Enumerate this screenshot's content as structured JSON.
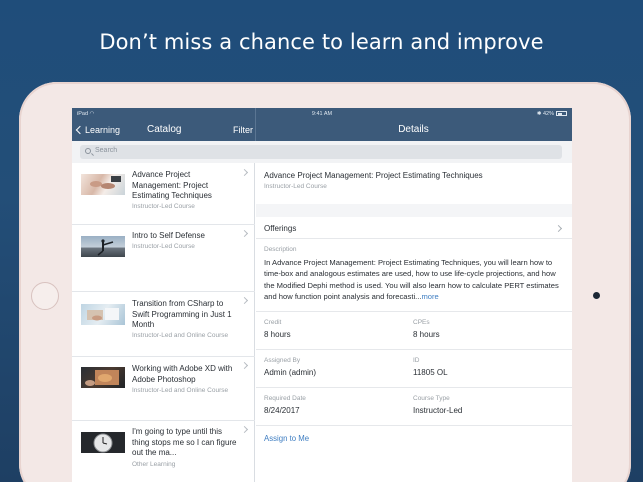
{
  "headline": "Don’t miss a chance to learn and improve",
  "status_bar": {
    "device": "iPad",
    "time": "9:41 AM",
    "battery": "42%"
  },
  "nav": {
    "back_label": "Learning",
    "catalog_title": "Catalog",
    "filter_label": "Filter",
    "details_title": "Details"
  },
  "search": {
    "placeholder": "Search"
  },
  "catalog_items": [
    {
      "title": "Advance Project Management: Project Estimating Techniques",
      "subtitle": "Instructor-Led Course"
    },
    {
      "title": "Intro to Self Defense",
      "subtitle": "Instructor-Led Course"
    },
    {
      "title": "Transition from CSharp to Swift Programming in Just 1 Month",
      "subtitle": "Instructor-Led and Online Course"
    },
    {
      "title": "Working with Adobe XD with Adobe Photoshop",
      "subtitle": "Instructor-Led and Online Course"
    },
    {
      "title": "I'm going to type until this thing stops me so I can figure out the ma...",
      "subtitle": "Other Learning"
    }
  ],
  "detail": {
    "title": "Advance Project Management: Project Estimating Techniques",
    "type": "Instructor-Led Course",
    "offerings_label": "Offerings",
    "description_label": "Description",
    "description": "In Advance Project Management: Project Estimating Techniques, you will learn how to time-box and analogous estimates are used, how to use life-cycle projections, and how the Modified Dephi method is used. You will also learn how to calculate PERT estimates and how function point analysis and forecasti...",
    "more_label": "more",
    "credit_label": "Credit",
    "credit_value": "8 hours",
    "cpes_label": "CPEs",
    "cpes_value": "8 hours",
    "assigned_by_label": "Assigned By",
    "assigned_by_value": "Admin (admin)",
    "id_label": "ID",
    "id_value": "11805 OL",
    "required_date_label": "Required Date",
    "required_date_value": "8/24/2017",
    "course_type_label": "Course Type",
    "course_type_value": "Instructor-Led",
    "assign_label": "Assign to Me"
  },
  "colors": {
    "navbar": "#3c5a7a",
    "accent": "#3f7ec2",
    "background": "#1f4d7a"
  }
}
